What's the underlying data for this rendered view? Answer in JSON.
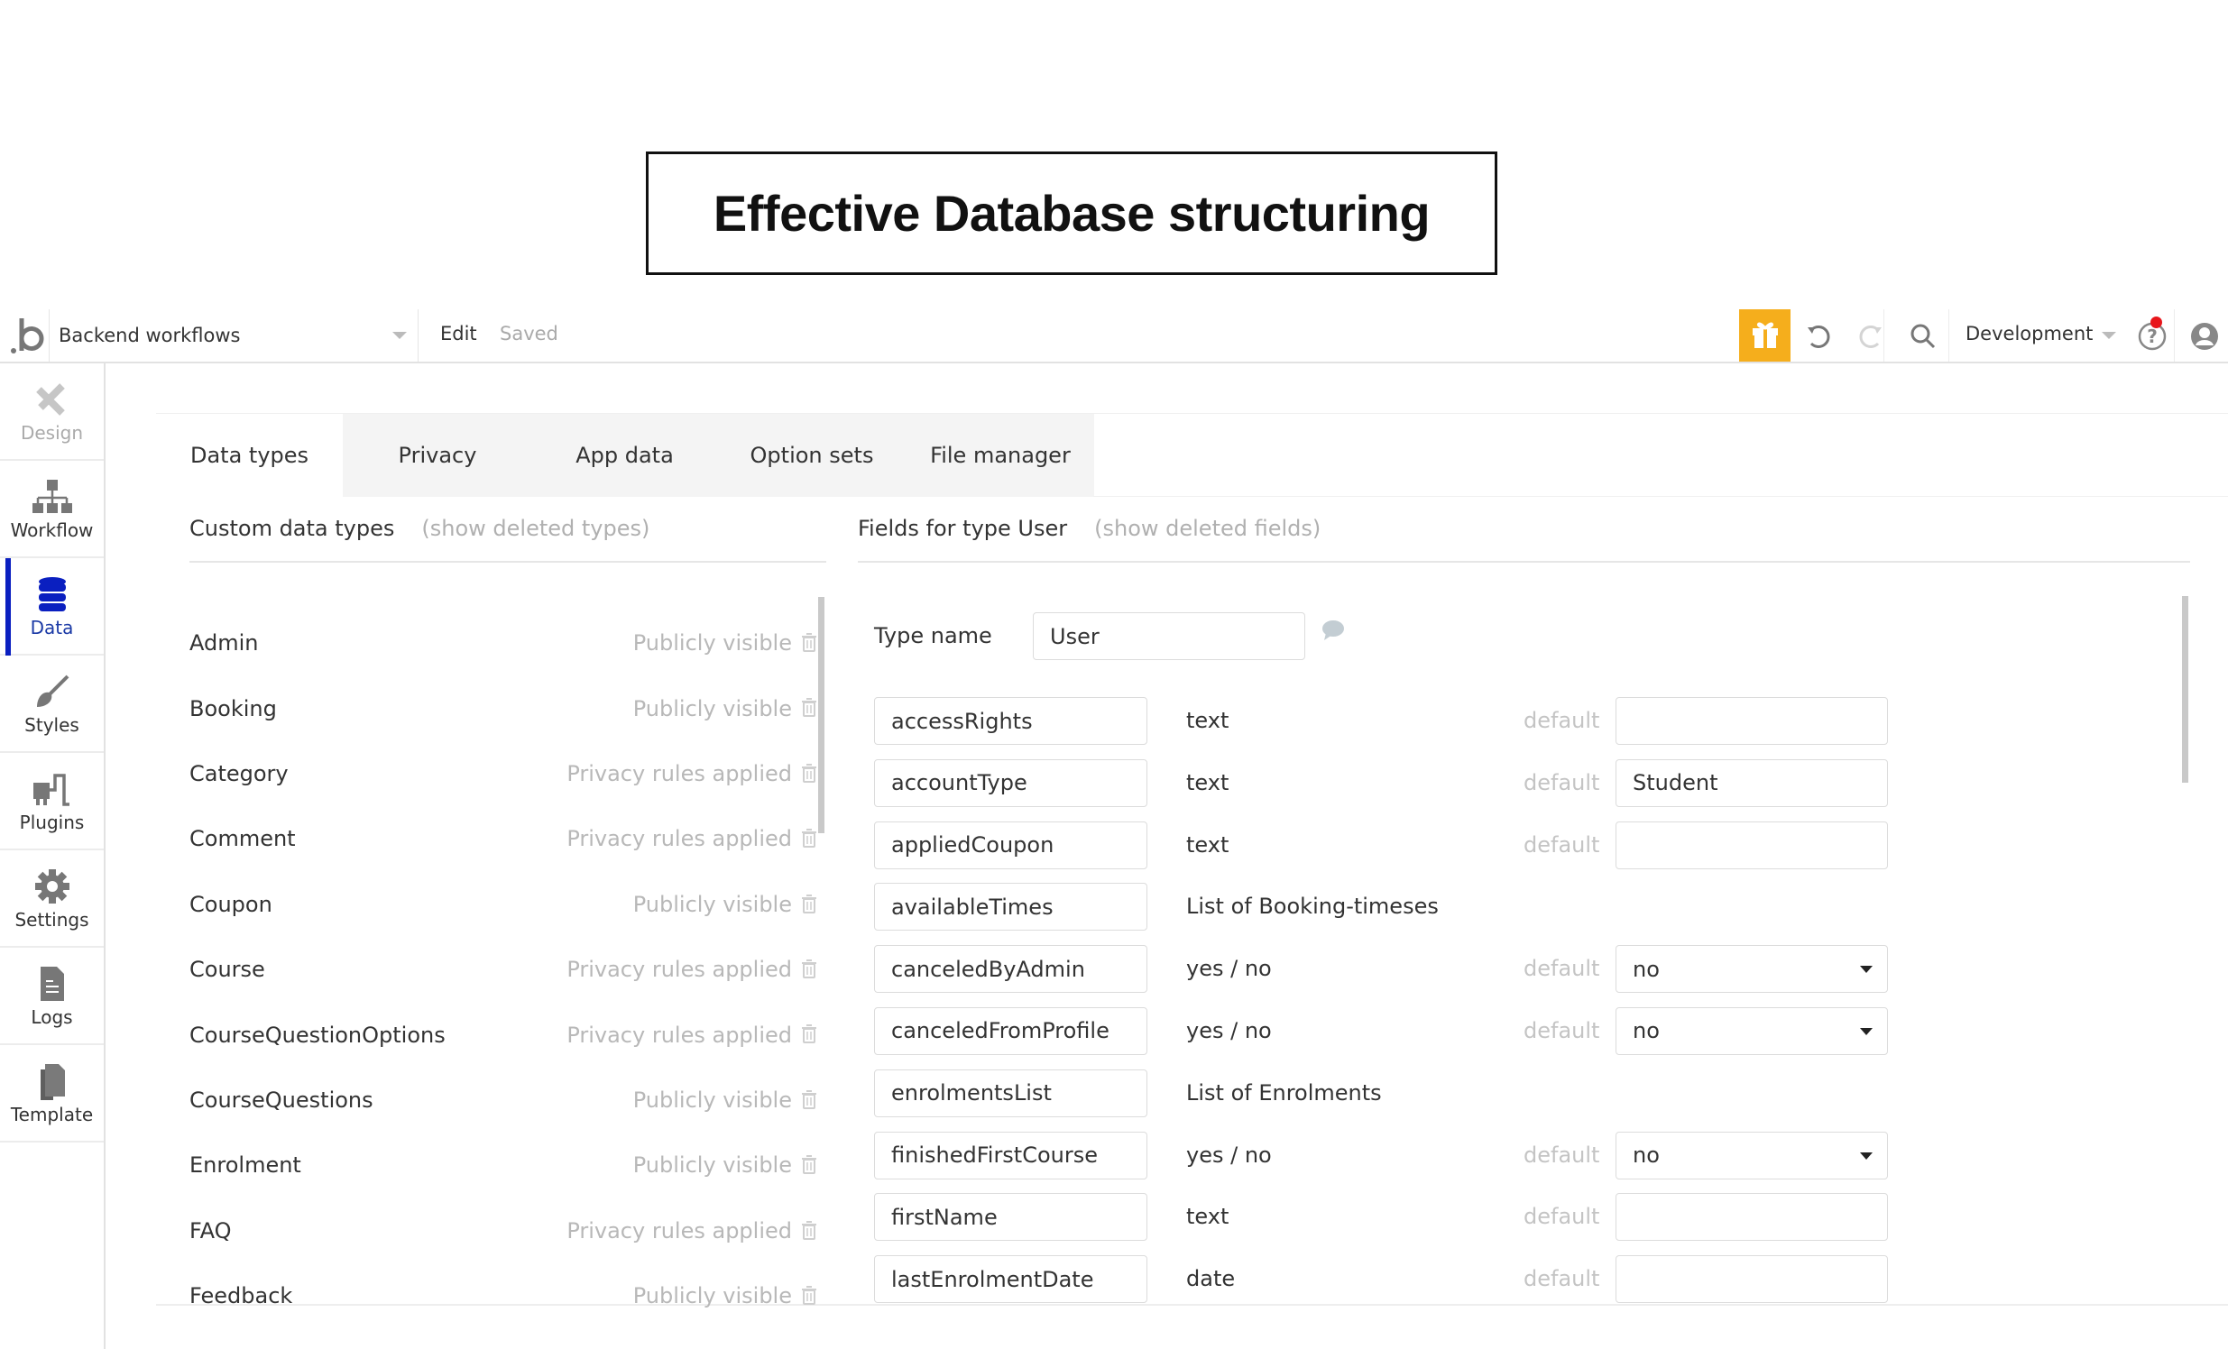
{
  "title": "Effective Database structuring",
  "header": {
    "page_name": "Backend workflows",
    "edit_label": "Edit",
    "status": "Saved",
    "environment": "Development",
    "icons": [
      "gift-icon",
      "undo-icon",
      "redo-icon",
      "search-icon",
      "help-icon",
      "account-icon"
    ]
  },
  "sidebar": {
    "items": [
      {
        "label": "Design",
        "icon": "design-icon",
        "state": "disabled"
      },
      {
        "label": "Workflow",
        "icon": "workflow-icon",
        "state": "normal"
      },
      {
        "label": "Data",
        "icon": "database-icon",
        "state": "active"
      },
      {
        "label": "Styles",
        "icon": "brush-icon",
        "state": "normal"
      },
      {
        "label": "Plugins",
        "icon": "plugin-icon",
        "state": "normal"
      },
      {
        "label": "Settings",
        "icon": "gear-icon",
        "state": "normal"
      },
      {
        "label": "Logs",
        "icon": "document-icon",
        "state": "normal"
      },
      {
        "label": "Template",
        "icon": "template-icon",
        "state": "normal"
      }
    ],
    "accent_color": "#0a1fc0"
  },
  "tabs": [
    {
      "label": "Data types",
      "active": true
    },
    {
      "label": "Privacy",
      "active": false
    },
    {
      "label": "App data",
      "active": false
    },
    {
      "label": "Option sets",
      "active": false
    },
    {
      "label": "File manager",
      "active": false
    }
  ],
  "custom_types": {
    "heading": "Custom data types",
    "show_deleted": "(show deleted types)",
    "items": [
      {
        "name": "Admin",
        "visibility": "Publicly visible"
      },
      {
        "name": "Booking",
        "visibility": "Publicly visible"
      },
      {
        "name": "Category",
        "visibility": "Privacy rules applied"
      },
      {
        "name": "Comment",
        "visibility": "Privacy rules applied"
      },
      {
        "name": "Coupon",
        "visibility": "Publicly visible"
      },
      {
        "name": "Course",
        "visibility": "Privacy rules applied"
      },
      {
        "name": "CourseQuestionOptions",
        "visibility": "Privacy rules applied"
      },
      {
        "name": "CourseQuestions",
        "visibility": "Publicly visible"
      },
      {
        "name": "Enrolment",
        "visibility": "Publicly visible"
      },
      {
        "name": "FAQ",
        "visibility": "Privacy rules applied"
      },
      {
        "name": "Feedback",
        "visibility": "Publicly visible"
      }
    ]
  },
  "fields_panel": {
    "heading": "Fields for type User",
    "show_deleted": "(show deleted fields)",
    "type_name_label": "Type name",
    "type_name_value": "User",
    "default_label": "default",
    "fields": [
      {
        "name": "accessRights",
        "type": "text",
        "has_default": true,
        "default_kind": "text",
        "default_value": "",
        "comment_filled": true
      },
      {
        "name": "accountType",
        "type": "text",
        "has_default": true,
        "default_kind": "text",
        "default_value": "Student",
        "comment_filled": false
      },
      {
        "name": "appliedCoupon",
        "type": "text",
        "has_default": true,
        "default_kind": "text",
        "default_value": "",
        "comment_filled": true
      },
      {
        "name": "availableTimes",
        "type": "List of Booking-timeses",
        "has_default": false,
        "default_kind": "",
        "default_value": "",
        "comment_filled": false
      },
      {
        "name": "canceledByAdmin",
        "type": "yes / no",
        "has_default": true,
        "default_kind": "dropdown",
        "default_value": "no",
        "comment_filled": true
      },
      {
        "name": "canceledFromProfile",
        "type": "yes / no",
        "has_default": true,
        "default_kind": "dropdown",
        "default_value": "no",
        "comment_filled": true
      },
      {
        "name": "enrolmentsList",
        "type": "List of Enrolments",
        "has_default": false,
        "default_kind": "",
        "default_value": "",
        "comment_filled": true
      },
      {
        "name": "finishedFirstCourse",
        "type": "yes / no",
        "has_default": true,
        "default_kind": "dropdown",
        "default_value": "no",
        "comment_filled": true
      },
      {
        "name": "firstName",
        "type": "text",
        "has_default": true,
        "default_kind": "text",
        "default_value": "",
        "comment_filled": true
      },
      {
        "name": "lastEnrolmentDate",
        "type": "date",
        "has_default": true,
        "default_kind": "text",
        "default_value": "",
        "comment_filled": true
      }
    ]
  }
}
